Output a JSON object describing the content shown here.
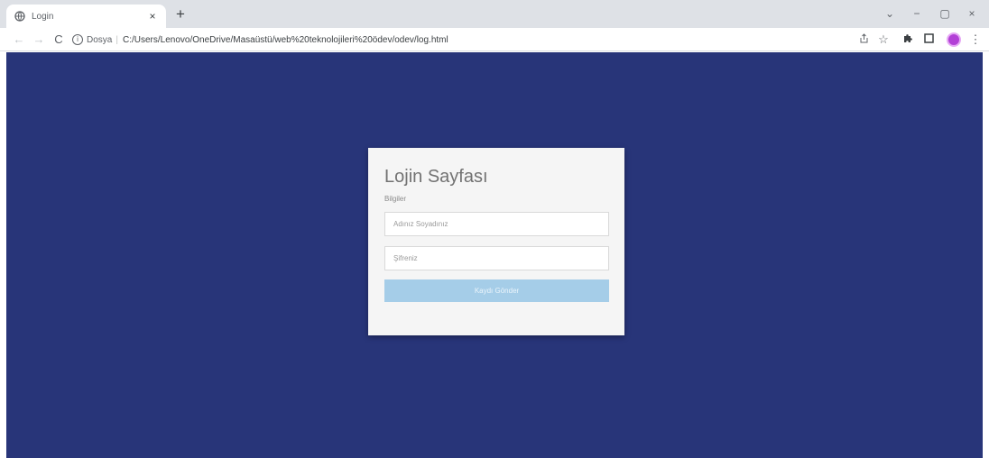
{
  "browser": {
    "tab_title": "Login",
    "tab_close": "×",
    "new_tab": "+",
    "controls": {
      "collapse": "⌄",
      "minimize": "−",
      "restore": "▢",
      "close": "×"
    },
    "nav": {
      "back": "←",
      "forward": "→",
      "reload": "C"
    },
    "security_chip": "Dosya",
    "separator": "|",
    "url": "C:/Users/Lenovo/OneDrive/Masaüstü/web%20teknolojileri%20ödev/odev/log.html",
    "toolbar_icons": [
      "share-icon",
      "star-icon",
      "extensions-icon",
      "sidepanel-icon",
      "profile-avatar",
      "menu-icon"
    ]
  },
  "login": {
    "title": "Lojin Sayfası",
    "subtitle": "Bilgiler",
    "name_placeholder": "Adınız Soyadınız",
    "password_placeholder": "Şifreniz",
    "submit_label": "Kaydı Gönder"
  },
  "colors": {
    "page_background": "#283579",
    "card_background": "#f5f5f5",
    "button_background": "#a5cde8",
    "avatar": "#b23fd6"
  }
}
